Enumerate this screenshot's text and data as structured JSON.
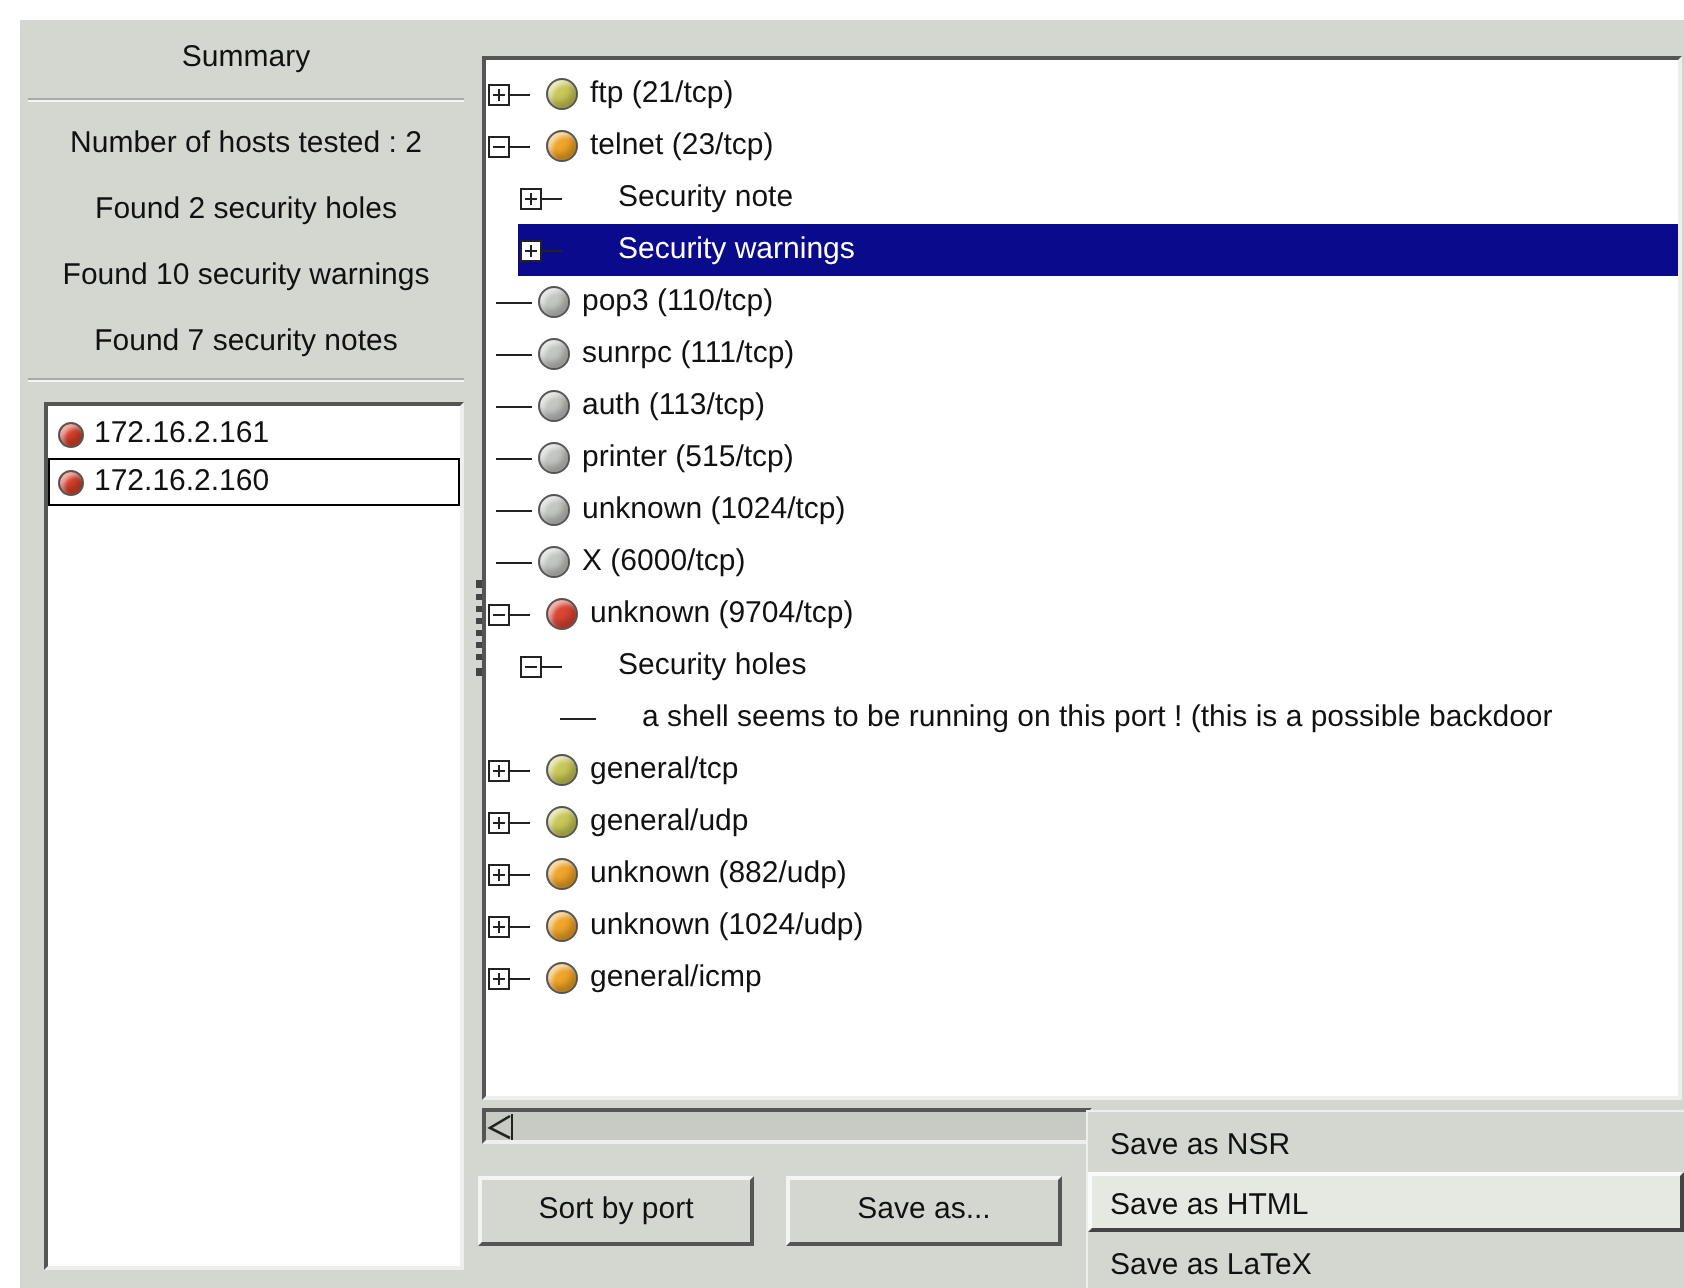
{
  "summary": {
    "title": "Summary",
    "stats": [
      "Number of hosts tested : 2",
      "Found 2 security holes",
      "Found 10 security warnings",
      "Found 7 security notes"
    ]
  },
  "hosts": [
    {
      "label": "172.16.2.161",
      "color": "#d8402c",
      "selected": false
    },
    {
      "label": "172.16.2.160",
      "color": "#d8402c",
      "selected": true
    }
  ],
  "tree": [
    {
      "label": "ftp (21/tcp)",
      "color": "#c8c858",
      "expanded": false,
      "selected": false
    },
    {
      "label": "telnet (23/tcp)",
      "color": "#f0a428",
      "expanded": true,
      "selected": false,
      "children": [
        {
          "label": "Security note",
          "expanded": false,
          "selected": false
        },
        {
          "label": "Security warnings",
          "expanded": false,
          "selected": true
        }
      ]
    },
    {
      "label": "pop3 (110/tcp)",
      "color": "#c4c6c2",
      "selected": false
    },
    {
      "label": "sunrpc (111/tcp)",
      "color": "#c4c6c2",
      "selected": false
    },
    {
      "label": "auth (113/tcp)",
      "color": "#c4c6c2",
      "selected": false
    },
    {
      "label": "printer (515/tcp)",
      "color": "#c4c6c2",
      "selected": false
    },
    {
      "label": "unknown (1024/tcp)",
      "color": "#c4c6c2",
      "selected": false
    },
    {
      "label": "X (6000/tcp)",
      "color": "#c4c6c2",
      "selected": false
    },
    {
      "label": "unknown (9704/tcp)",
      "color": "#dc4434",
      "expanded": true,
      "selected": false,
      "children": [
        {
          "label": "Security holes",
          "expanded": true,
          "selected": false,
          "children": [
            {
              "label": "a shell seems to be running on this port ! (this is a possible backdoor",
              "selected": false
            }
          ]
        }
      ]
    },
    {
      "label": "general/tcp",
      "color": "#c8c858",
      "expanded": false,
      "selected": false
    },
    {
      "label": "general/udp",
      "color": "#c8c858",
      "expanded": false,
      "selected": false
    },
    {
      "label": "unknown (882/udp)",
      "color": "#f0a428",
      "expanded": false,
      "selected": false
    },
    {
      "label": "unknown (1024/udp)",
      "color": "#f0a428",
      "expanded": false,
      "selected": false
    },
    {
      "label": "general/icmp",
      "color": "#f0a428",
      "expanded": false,
      "selected": false
    }
  ],
  "buttons": [
    "Sort by port",
    "Save as..."
  ],
  "menu": [
    {
      "label": "Save as NSR",
      "selected": false
    },
    {
      "label": "Save as HTML",
      "selected": true
    },
    {
      "label": "Save as LaTeX",
      "selected": false
    }
  ]
}
